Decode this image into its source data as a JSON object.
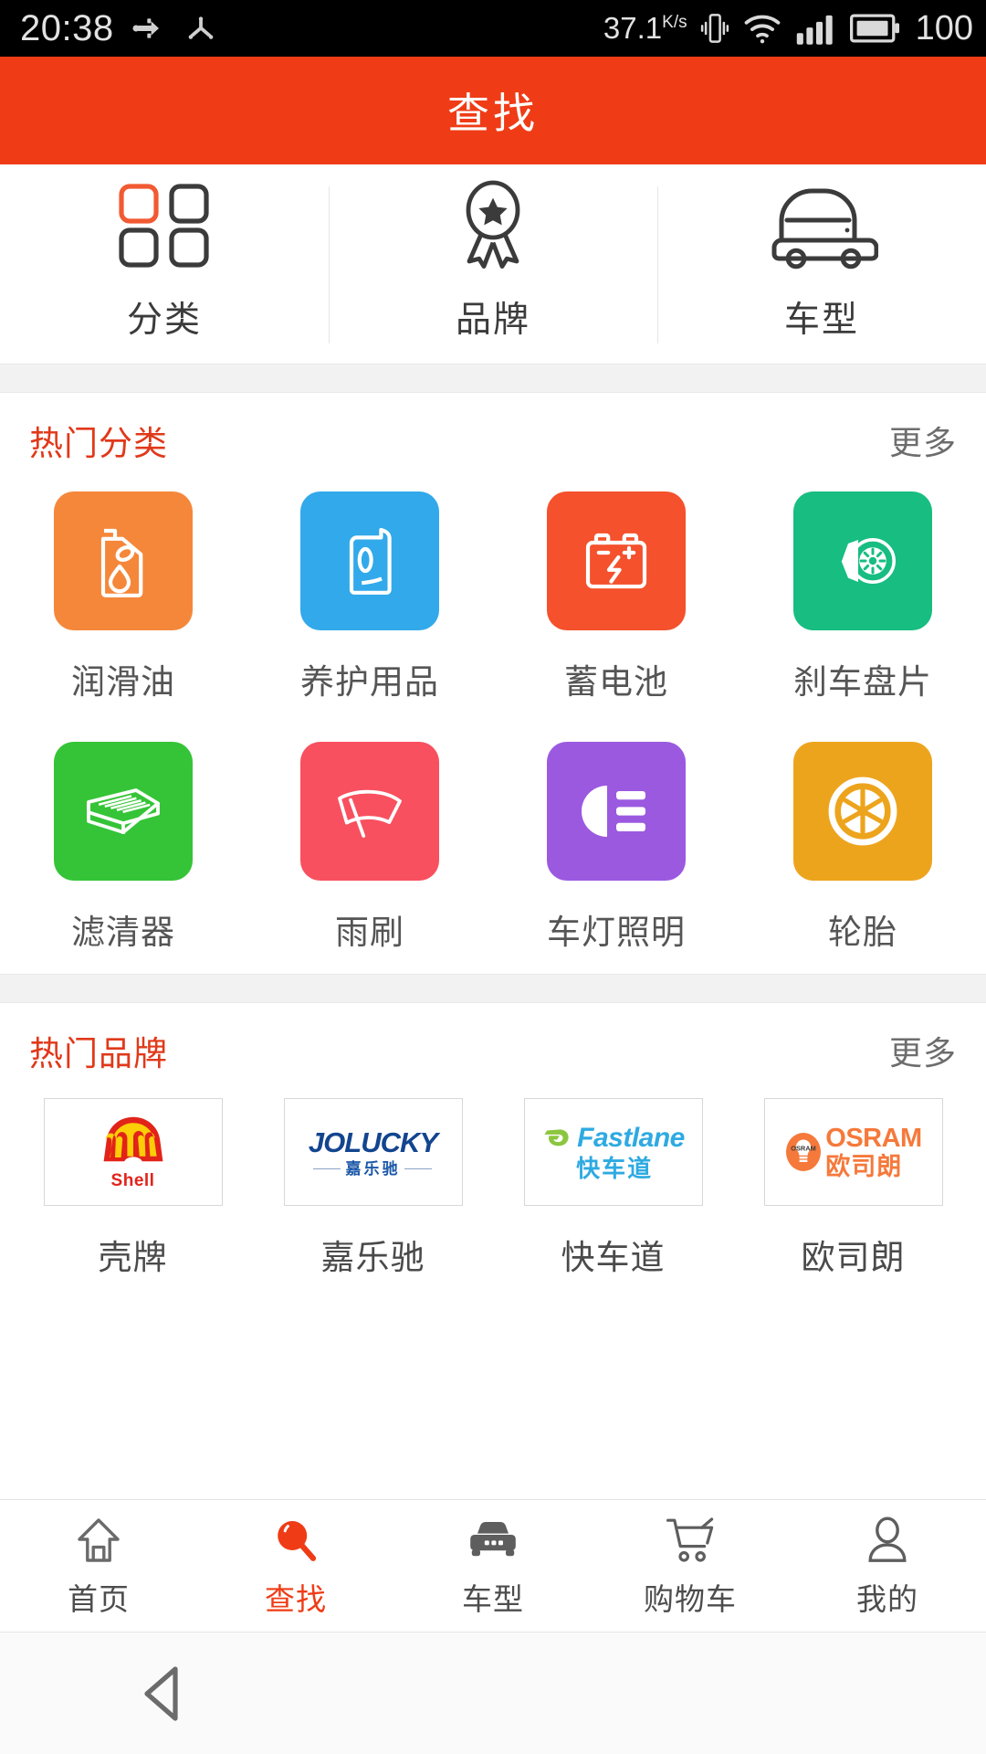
{
  "status_bar": {
    "time": "20:38",
    "usb_icon": "usb-icon",
    "share_icon": "share-icon",
    "network_speed": "37.1",
    "network_speed_unit": "K/s",
    "vibrate_icon": "vibrate-icon",
    "wifi_icon": "wifi-icon",
    "signal_icon": "signal-bars-icon",
    "battery_icon": "battery-icon",
    "battery_level": "100"
  },
  "header": {
    "title": "查找"
  },
  "top_nav": {
    "items": [
      {
        "label": "分类",
        "icon": "grid-icon"
      },
      {
        "label": "品牌",
        "icon": "award-badge-icon"
      },
      {
        "label": "车型",
        "icon": "car-icon"
      }
    ]
  },
  "hot_categories": {
    "title": "热门分类",
    "more_label": "更多",
    "items": [
      {
        "label": "润滑油",
        "color": "#f5873a",
        "icon": "oil-bottle-icon"
      },
      {
        "label": "养护用品",
        "color": "#32a9ea",
        "icon": "care-product-icon"
      },
      {
        "label": "蓄电池",
        "color": "#f4512c",
        "icon": "battery-cell-icon"
      },
      {
        "label": "刹车盘片",
        "color": "#17bd81",
        "icon": "brake-disc-icon"
      },
      {
        "label": "滤清器",
        "color": "#35c437",
        "icon": "air-filter-icon"
      },
      {
        "label": "雨刷",
        "color": "#f8505f",
        "icon": "wiper-blade-icon"
      },
      {
        "label": "车灯照明",
        "color": "#9b59e0",
        "icon": "headlight-icon"
      },
      {
        "label": "轮胎",
        "color": "#edа41d",
        "icon": "wheel-icon"
      }
    ]
  },
  "hot_brands": {
    "title": "热门品牌",
    "more_label": "更多",
    "items": [
      {
        "label": "壳牌",
        "logo_text": "Shell",
        "logo_sub": "",
        "logo_icon": "shell-logo",
        "logo_color": "#e2231a"
      },
      {
        "label": "嘉乐驰",
        "logo_text": "JOLUCKY",
        "logo_sub": "嘉乐驰",
        "logo_icon": "jolucky-logo",
        "logo_color": "#13458f"
      },
      {
        "label": "快车道",
        "logo_text": "Fastlane",
        "logo_sub": "快车道",
        "logo_icon": "fastlane-logo",
        "logo_color": "#2eaae1"
      },
      {
        "label": "欧司朗",
        "logo_text": "OSRAM",
        "logo_sub": "欧司朗",
        "logo_icon": "osram-logo",
        "logo_color": "#f5793b"
      }
    ]
  },
  "tab_bar": {
    "items": [
      {
        "label": "首页",
        "icon": "home-icon",
        "active": false
      },
      {
        "label": "查找",
        "icon": "search-icon",
        "active": true
      },
      {
        "label": "车型",
        "icon": "car-icon",
        "active": false
      },
      {
        "label": "购物车",
        "icon": "cart-icon",
        "active": false
      },
      {
        "label": "我的",
        "icon": "person-icon",
        "active": false
      }
    ],
    "active_color": "#ef3c16"
  },
  "system_nav": {
    "back_icon": "back-triangle-icon"
  },
  "theme": {
    "brand_red": "#ef3c16",
    "section_red": "#e0391a",
    "page_bg": "#f2f2f2"
  }
}
